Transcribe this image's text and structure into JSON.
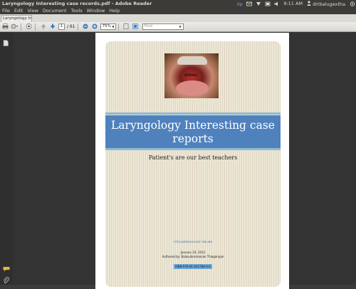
{
  "window": {
    "title": "Laryngology Interesting case records.pdf - Adobe Reader",
    "clock": "9:11 AM",
    "user": "drtbalugextha"
  },
  "menu": [
    "File",
    "Edit",
    "View",
    "Document",
    "Tools",
    "Window",
    "Help"
  ],
  "tab": {
    "label": "Laryngology Int..."
  },
  "toolbar": {
    "current_page": "1",
    "page_total": "/ 61",
    "zoom": "75%",
    "find_placeholder": "Find"
  },
  "document": {
    "watermark": "drtbalu",
    "title": "Laryngology Interesting case reports",
    "subtitle": "Patient's are our best teachers",
    "site": "OTOLARYNGOLOGY ONLINE",
    "date": "January 16, 2012",
    "author": "Authored by: Balasubramanian Thiagarajan",
    "isbn": "ISBN 978-81-921784-6-6"
  },
  "colors": {
    "banner": "#4f81bd",
    "banner_accent": "#8cbad8",
    "card_bg": "#ede7d6"
  }
}
